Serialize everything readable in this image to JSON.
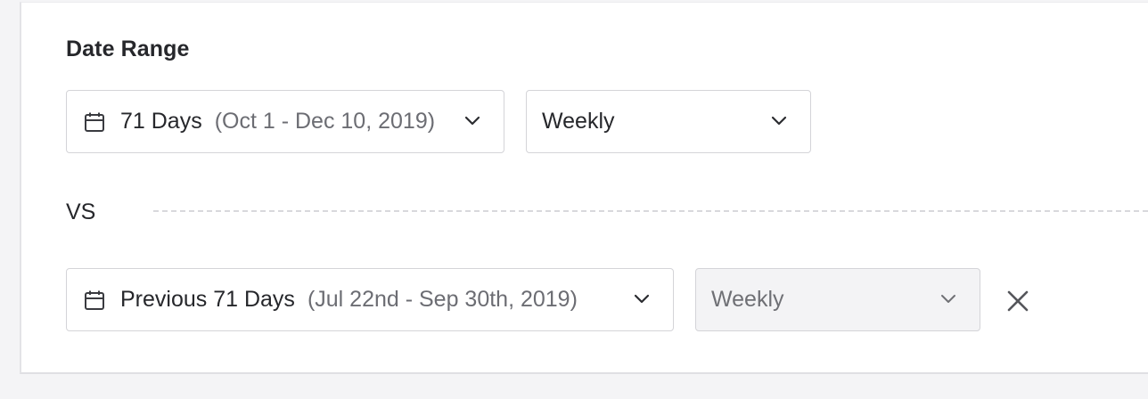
{
  "section": {
    "title": "Date Range"
  },
  "primary": {
    "range_label": "71 Days",
    "range_dates": "(Oct 1 - Dec 10, 2019)",
    "interval": "Weekly"
  },
  "comparison": {
    "separator_label": "VS",
    "range_label": "Previous 71 Days",
    "range_dates": "(Jul 22nd - Sep 30th, 2019)",
    "interval": "Weekly",
    "interval_disabled": true
  },
  "icons": {
    "calendar": "calendar-icon",
    "chevron": "chevron-down-icon",
    "remove": "close-icon"
  },
  "colors": {
    "border": "#d4d4d8",
    "disabled_bg": "#f3f3f5",
    "text": "#26272b",
    "muted_text": "#6c6d73"
  }
}
